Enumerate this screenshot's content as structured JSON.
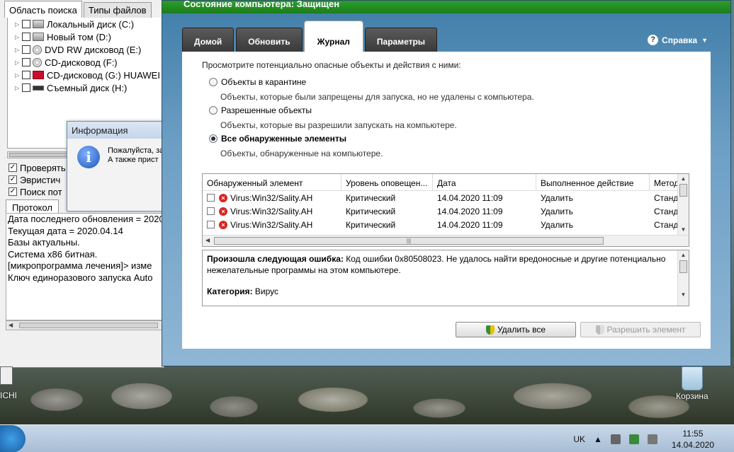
{
  "left_panel": {
    "tabs": [
      "Область поиска",
      "Типы файлов"
    ],
    "drives": [
      {
        "label": "Локальный диск (C:)",
        "type": "hdd"
      },
      {
        "label": "Новый том (D:)",
        "type": "hdd"
      },
      {
        "label": "DVD RW дисковод (E:)",
        "type": "dvd"
      },
      {
        "label": "CD-дисковод (F:)",
        "type": "cd"
      },
      {
        "label": "CD-дисковод (G:) HUAWEI",
        "type": "huawei"
      },
      {
        "label": "Съемный диск (H:)",
        "type": "removable"
      }
    ],
    "options": [
      {
        "label": "Проверять",
        "checked": true
      },
      {
        "label": "Эвристич",
        "checked": true
      },
      {
        "label": "Поиск пот",
        "checked": true
      }
    ],
    "protocol_tab": "Протокол",
    "log": [
      "Дата последнего обновления = 2020",
      "Текущая дата = 2020.04.14",
      "Базы актуальны.",
      "Система x86 битная.",
      "[микропрограмма лечения]> изме",
      "Ключ единоразового запуска Auto"
    ]
  },
  "info_dialog": {
    "title": "Информация",
    "icon": "info-icon",
    "line1": "Пожалуйста, за",
    "line2": "А также прист"
  },
  "main": {
    "status": "Состояние компьютера: Защищен",
    "tabs": [
      "Домой",
      "Обновить",
      "Журнал",
      "Параметры"
    ],
    "active_tab": "Журнал",
    "help": "Справка",
    "intro": "Просмотрите потенциально опасные объекты и действия с ними:",
    "radios": [
      {
        "label": "Объекты в карантине",
        "desc": "Объекты, которые были запрещены для запуска, но не удалены с компьютера.",
        "selected": false
      },
      {
        "label": "Разрешенные объекты",
        "desc": "Объекты, которые вы разрешили запускать на компьютере.",
        "selected": false
      },
      {
        "label": "Все обнаруженные элементы",
        "desc": "Объекты, обнаруженные на компьютере.",
        "selected": true
      }
    ],
    "table": {
      "columns": [
        "Обнаруженный элемент",
        "Уровень оповещен...",
        "Дата",
        "Выполненное действие",
        "Метод"
      ],
      "rows": [
        [
          "Virus:Win32/Sality.AH",
          "Критический",
          "14.04.2020 11:09",
          "Удалить",
          "Станд"
        ],
        [
          "Virus:Win32/Sality.AH",
          "Критический",
          "14.04.2020 11:09",
          "Удалить",
          "Станд"
        ],
        [
          "Virus:Win32/Sality.AH",
          "Критический",
          "14.04.2020 11:09",
          "Удалить",
          "Станд"
        ]
      ]
    },
    "details": {
      "error_label": "Произошла следующая ошибка:",
      "error_text": " Код ошибки 0x80508023. Не удалось найти вредоносные и другие потенциально",
      "error_text2": "нежелательные программы на этом компьютере.",
      "category_label": "Категория:",
      "category_value": " Вирус"
    },
    "buttons": {
      "remove_all": "Удалить все",
      "allow": "Разрешить элемент"
    }
  },
  "desktop": {
    "left_icon_label": "ICHI",
    "recycle_label": "Корзина"
  },
  "taskbar": {
    "lang": "UK",
    "time": "11:55",
    "date": "14.04.2020"
  }
}
